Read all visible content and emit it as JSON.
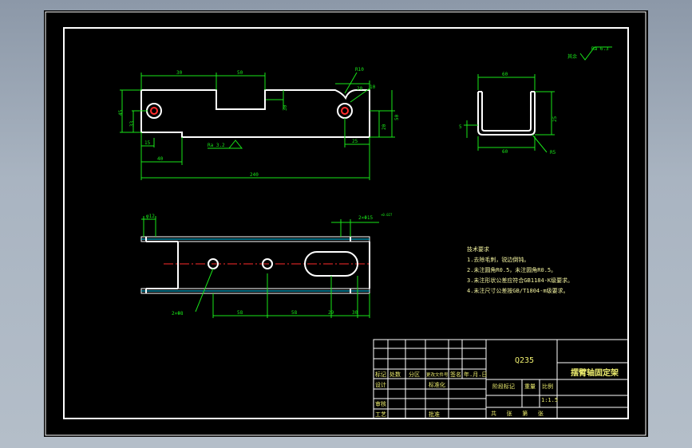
{
  "drawing": {
    "material": "Q235",
    "part_name": "摆臂轴固定架",
    "scale": "1:1.5",
    "roughness_label": "其余",
    "roughness_value": "Ra 6.3",
    "roughness_callout": "Ra 3.2"
  },
  "dimensions": {
    "front": {
      "d30": "30",
      "d50": "50",
      "d20": "20",
      "d30b": "30",
      "dR10": "R10",
      "d45": "45",
      "d33": "33",
      "d15": "15",
      "d40": "40",
      "d240": "240",
      "d20r": "20",
      "d10": "10",
      "d25": "25",
      "d50v": "50"
    },
    "side": {
      "d60t": "60",
      "d60b": "60",
      "d25": "25",
      "dR5": "R5",
      "d5": "5"
    },
    "top": {
      "phi12": "φ12",
      "holes2": "2×Φ15",
      "holes2b": "2×Φ8",
      "d58": "58",
      "d58b": "58",
      "d29": "29",
      "d30": "30",
      "tol": "+0.027"
    }
  },
  "notes": {
    "title": "技术要求",
    "items": [
      "1.去除毛刺，锐边倒钝。",
      "2.未注圆角R0.5，未注圆角R0.5。",
      "3.未注形状公差应符合GB1184-K级要求。",
      "4.未注尺寸公差按GB/T1804-m级要求。"
    ]
  },
  "title_block": {
    "row_headers": [
      "标记",
      "处数",
      "分区",
      "更改文件号",
      "签名",
      "年.月.日"
    ],
    "design": "设计",
    "standard": "标准化",
    "review": "审核",
    "process": "工艺",
    "approve": "批准",
    "stage": "阶段标记",
    "weight": "重量",
    "scale_label": "比例",
    "sheets": "共   张   第   张"
  }
}
